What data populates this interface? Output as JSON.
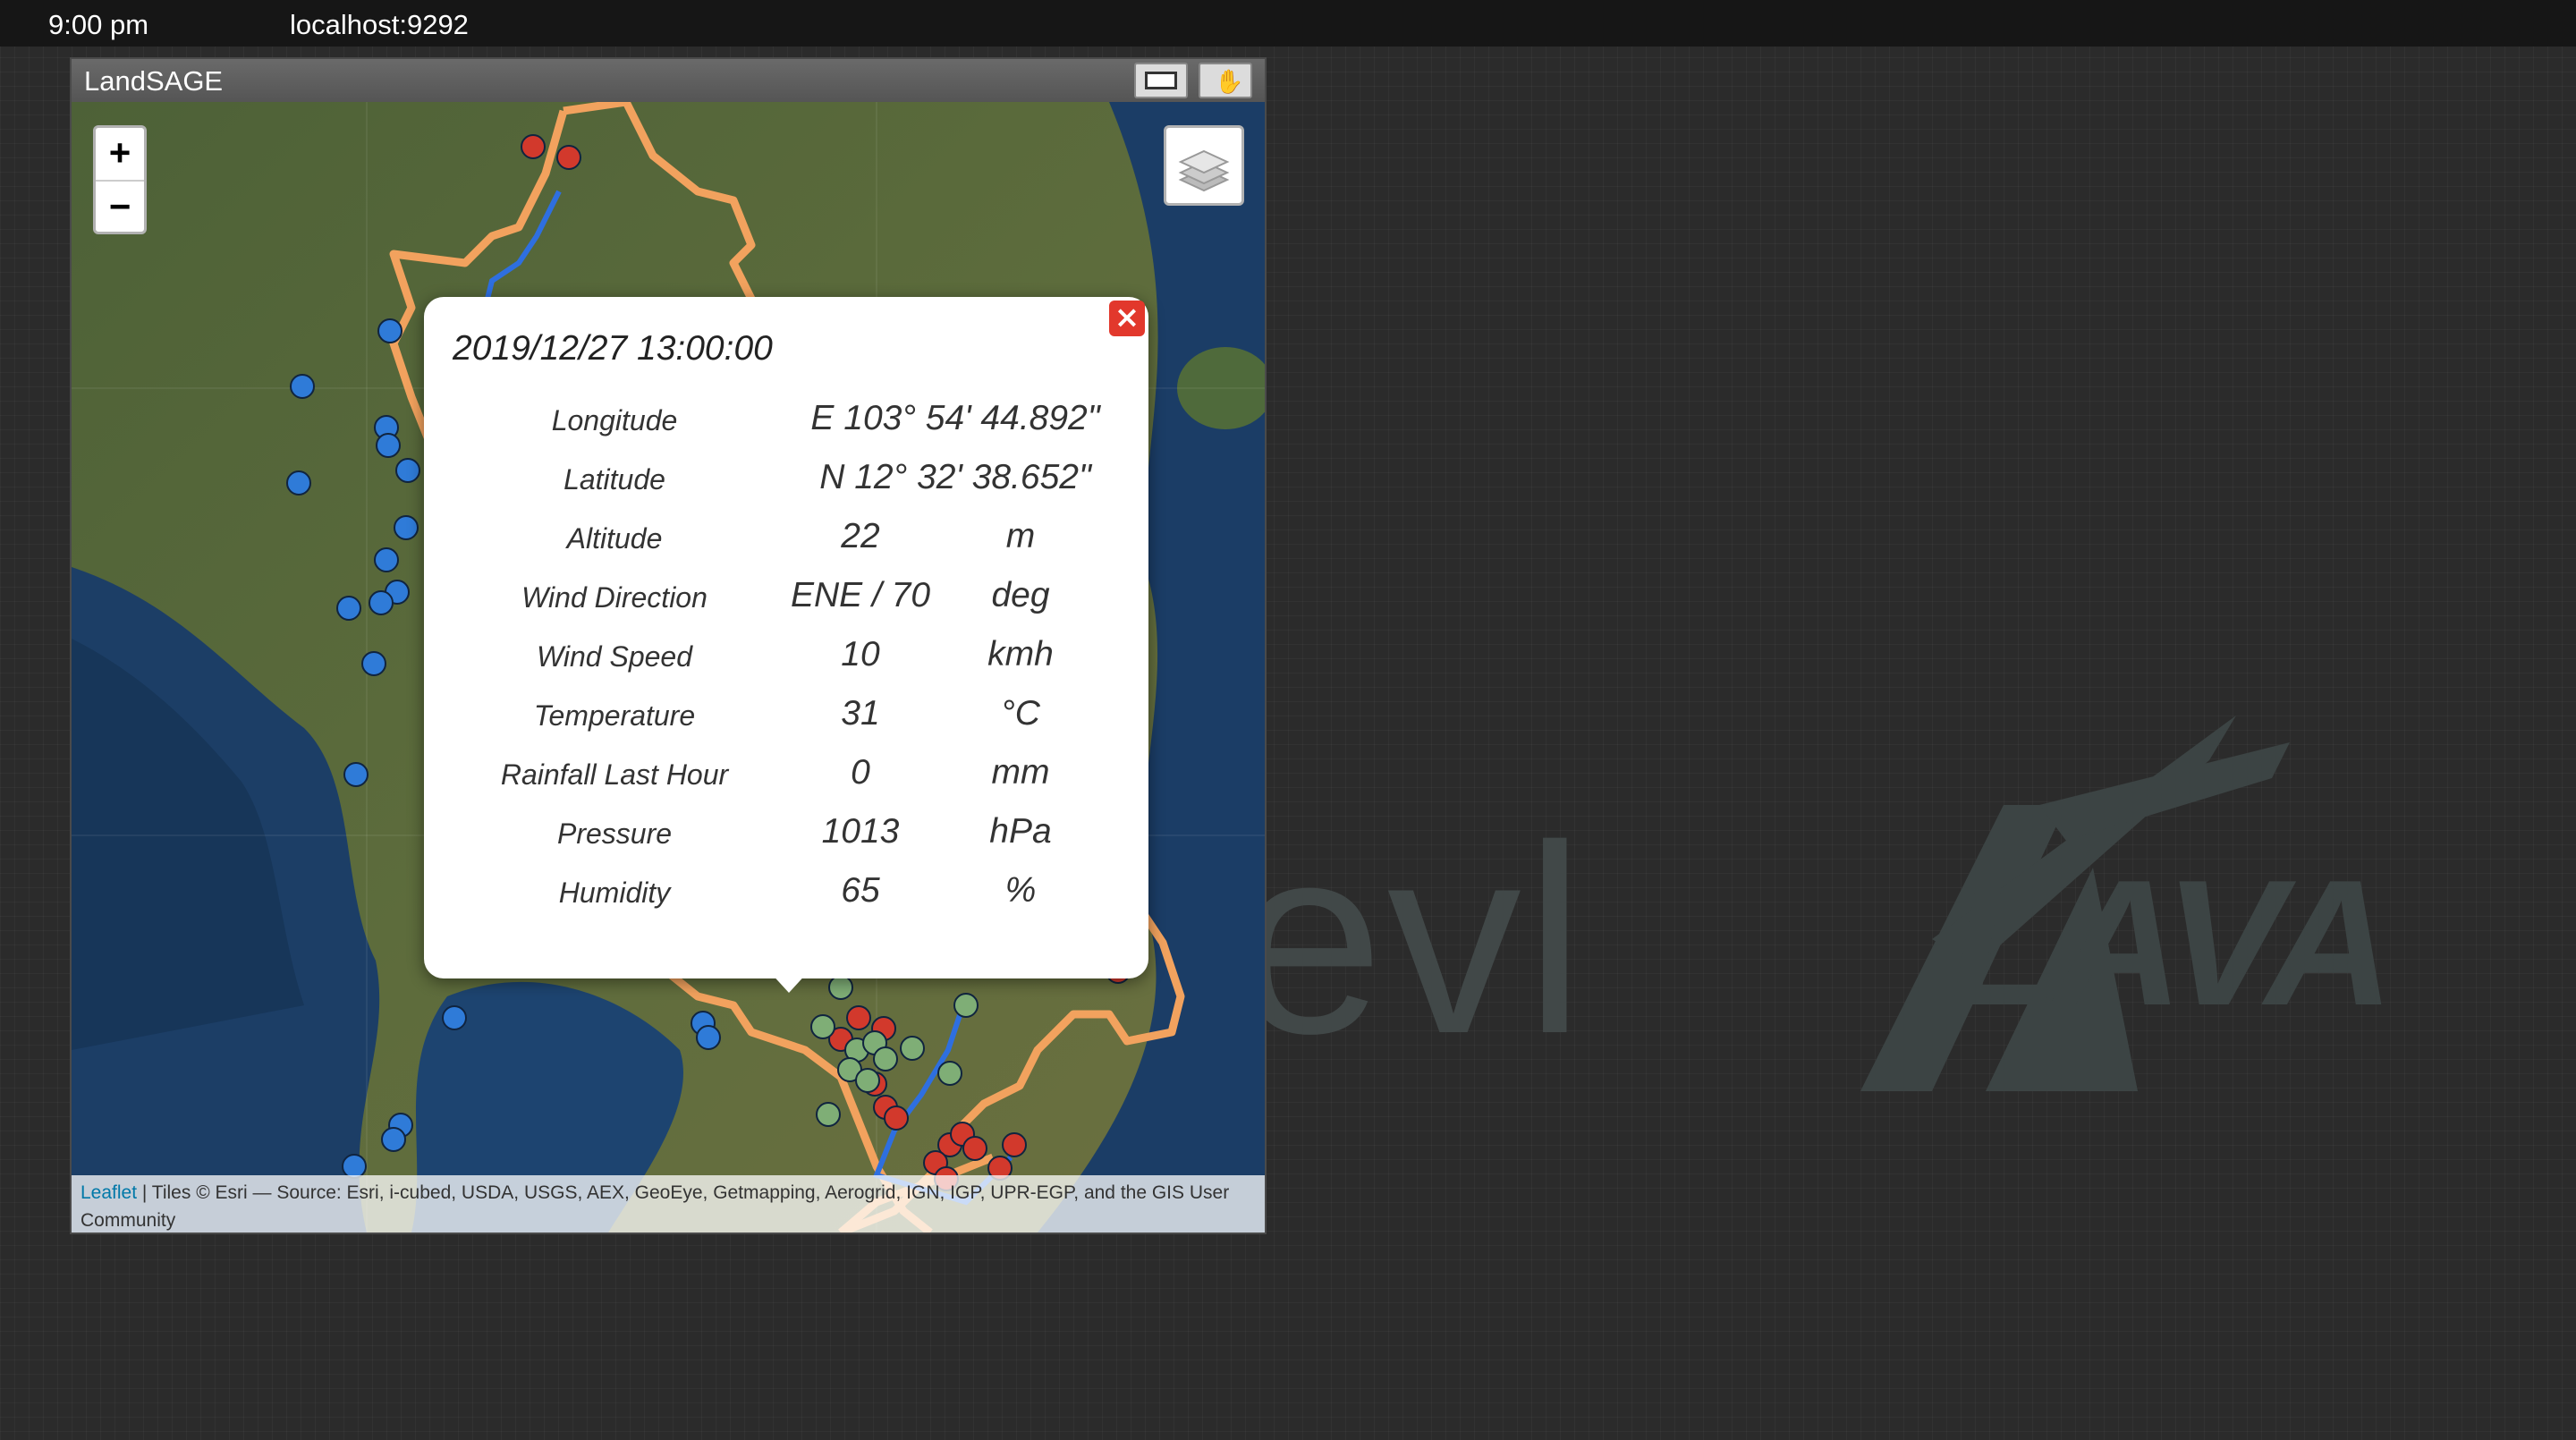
{
  "status_bar": {
    "time": "9:00 pm",
    "url": "localhost:9292"
  },
  "background_logo": {
    "text": "evl",
    "brand": "LAVA"
  },
  "window": {
    "title": "LandSAGE"
  },
  "map": {
    "zoom_in_label": "+",
    "zoom_out_label": "−",
    "attribution": {
      "leaflet": "Leaflet",
      "text": " | Tiles © Esri — Source: Esri, i-cubed, USDA, USGS, AEX, GeoEye, Getmapping, Aerogrid, IGN, IGP, UPR-EGP, and the GIS User Community"
    }
  },
  "popup": {
    "close_label": "×",
    "datetime": "2019/12/27 13:00:00",
    "rows": [
      {
        "label": "Longitude",
        "value": "E 103° 54' 44.892\"",
        "unit": ""
      },
      {
        "label": "Latitude",
        "value": "N 12° 32' 38.652\"",
        "unit": ""
      },
      {
        "label": "Altitude",
        "value": "22",
        "unit": "m"
      },
      {
        "label": "Wind Direction",
        "value": "ENE / 70",
        "unit": "deg"
      },
      {
        "label": "Wind Speed",
        "value": "10",
        "unit": "kmh"
      },
      {
        "label": "Temperature",
        "value": "31",
        "unit": "°C"
      },
      {
        "label": "Rainfall Last Hour",
        "value": "0",
        "unit": "mm"
      },
      {
        "label": "Pressure",
        "value": "1013",
        "unit": "hPa"
      },
      {
        "label": "Humidity",
        "value": "65",
        "unit": "%"
      }
    ]
  },
  "colors": {
    "station_blue": "#2f7bd8",
    "station_red": "#d2392c",
    "station_green": "#7fae76",
    "boundary_orange": "#f2a25e",
    "river_blue": "#2e6fe0",
    "close_red": "#e2382c"
  }
}
